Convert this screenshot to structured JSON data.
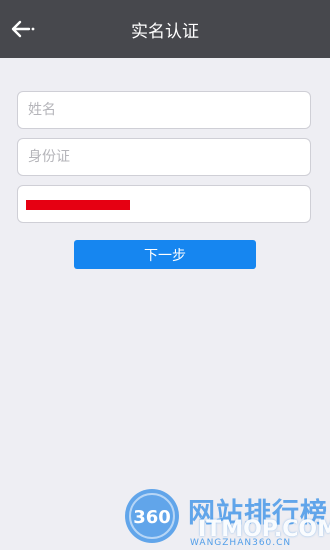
{
  "header": {
    "title": "实名认证",
    "back_icon": "back-arrow-icon",
    "background": "#47484d"
  },
  "form": {
    "name_placeholder": "姓名",
    "id_placeholder": "身份证",
    "redacted_field_color": "#e60012"
  },
  "actions": {
    "next_label": "下一步",
    "next_color": "#1686f0"
  },
  "watermark": {
    "logo_text": "360",
    "site_name": "网站排行榜",
    "brand": "ITMOP.COM",
    "url": "WANGZHAN360.CN"
  }
}
